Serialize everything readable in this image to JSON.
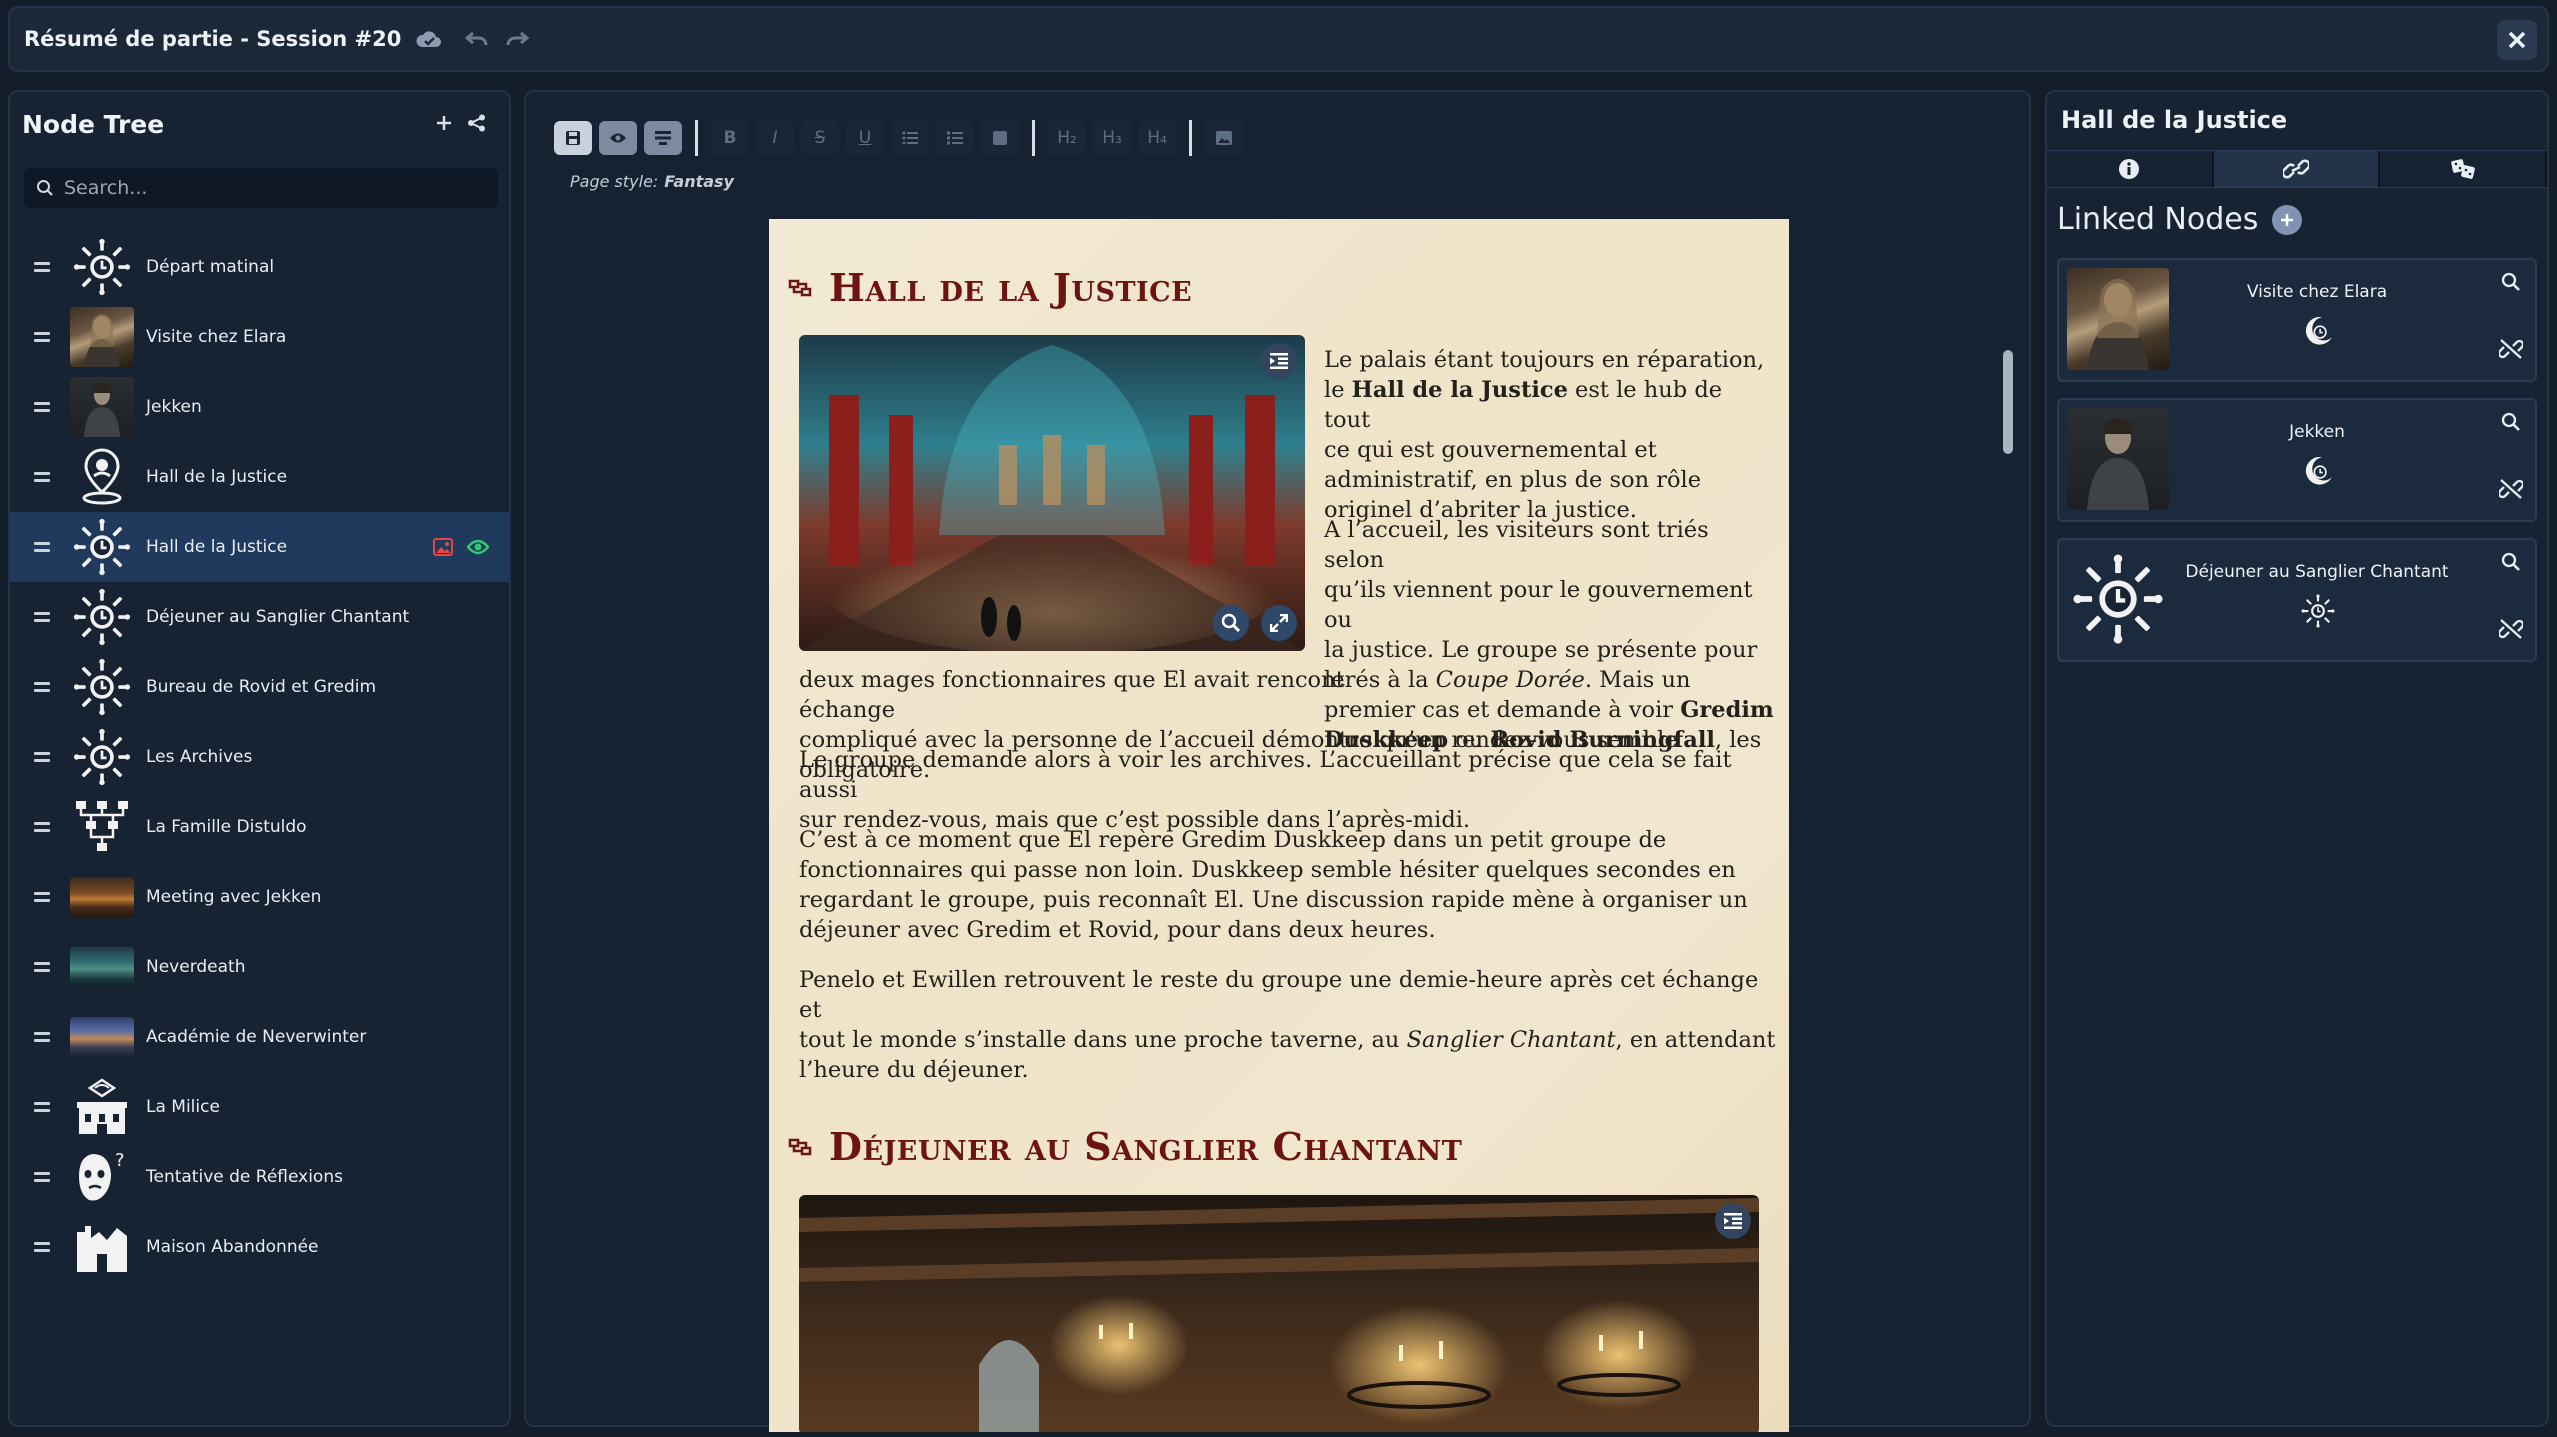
{
  "window": {
    "title": "Résumé de partie - Session #20"
  },
  "left_panel": {
    "title": "Node Tree",
    "search_placeholder": "Search...",
    "items": [
      {
        "label": "Départ matinal",
        "thumb": "event-sun-icon"
      },
      {
        "label": "Visite chez Elara",
        "thumb": "portrait-elara"
      },
      {
        "label": "Jekken",
        "thumb": "portrait-jekken"
      },
      {
        "label": "Hall de la Justice",
        "thumb": "location-pin-icon"
      },
      {
        "label": "Hall de la Justice",
        "thumb": "event-sun-icon",
        "selected": true
      },
      {
        "label": "Déjeuner au Sanglier Chantant",
        "thumb": "event-sun-icon"
      },
      {
        "label": "Bureau de Rovid et Gredim",
        "thumb": "event-sun-icon"
      },
      {
        "label": "Les Archives",
        "thumb": "event-sun-icon"
      },
      {
        "label": "La Famille Distuldo",
        "thumb": "family-tree-icon"
      },
      {
        "label": "Meeting avec Jekken",
        "thumb": "image-tavern"
      },
      {
        "label": "Neverdeath",
        "thumb": "image-forest"
      },
      {
        "label": "Académie de Neverwinter",
        "thumb": "image-city"
      },
      {
        "label": "La Milice",
        "thumb": "guild-hall-icon"
      },
      {
        "label": "Tentative de Réflexions",
        "thumb": "thinking-face-icon"
      },
      {
        "label": "Maison Abandonnée",
        "thumb": "ruined-house-icon"
      }
    ]
  },
  "editor": {
    "page_style_label": "Page style:",
    "page_style_value": "Fantasy",
    "toolbar": [
      "save",
      "preview",
      "format",
      "B",
      "I",
      "S",
      "U",
      "bullet-list",
      "numbered-list",
      "block",
      "H₂",
      "H₃",
      "H₄",
      "image"
    ],
    "section1": {
      "title": "Hall de la Justice",
      "p1_parts": [
        "Le palais étant toujours en réparation,",
        "le ",
        "Hall de la Justice",
        " est le hub de tout",
        "ce qui est gouvernemental et",
        "administratif, en plus de son rôle",
        "originel d’abriter la justice."
      ],
      "p2_parts": [
        "A l’accueil, les visiteurs sont triés selon",
        "qu’ils viennent pour le gouvernement ou",
        "la justice. Le groupe se présente pour le",
        "premier cas et demande à voir ",
        "Gredim",
        "Duskkeep",
        " ou ",
        "Rovid Burningfall",
        ", les",
        "deux mages fonctionnaires que El avait rencontrés à la ",
        "Coupe Dorée",
        ". Mais un échange",
        "compliqué avec la personne de l’accueil démontre qu’un rendez-vous semble obligatoire."
      ],
      "p3": [
        "Le groupe demande alors à voir les archives. L’accueillant précise que cela se fait aussi",
        "sur rendez-vous, mais que c’est possible dans l’après-midi."
      ],
      "p4": [
        "C’est à ce moment que El repère Gredim Duskkeep dans un petit groupe de",
        "fonctionnaires qui passe non loin. Duskkeep semble hésiter quelques secondes en",
        "regardant le groupe, puis reconnaît El. Une discussion rapide mène à organiser un",
        "déjeuner avec Gredim et Rovid, pour dans deux heures."
      ],
      "p5_parts": [
        "Penelo et Ewillen retrouvent le reste du groupe une demie-heure après cet échange et",
        "tout le monde s’installe dans une proche taverne, au ",
        "Sanglier Chantant",
        ", en attendant",
        "l’heure du déjeuner."
      ]
    },
    "section2": {
      "title": "Déjeuner au Sanglier Chantant"
    }
  },
  "right_panel": {
    "title": "Hall de la Justice",
    "tabs": [
      "info-icon",
      "link-icon",
      "dice-icon"
    ],
    "linked_title": "Linked Nodes",
    "linked": [
      {
        "name": "Visite chez Elara",
        "type_icon": "moon-clock-icon",
        "thumb": "portrait-elara"
      },
      {
        "name": "Jekken",
        "type_icon": "moon-clock-icon",
        "thumb": "portrait-jekken"
      },
      {
        "name": "Déjeuner au Sanglier Chantant",
        "type_icon": "sun-clock-icon",
        "thumb": "event-sun-icon"
      }
    ]
  },
  "colors": {
    "background": "#141d2a",
    "panel": "#172233",
    "selected": "#1f3a5c",
    "heading_red": "#6c1410",
    "parchment": "#f1e6cf",
    "eye_green": "#2ecc71",
    "image_badge_red": "#e04848"
  }
}
